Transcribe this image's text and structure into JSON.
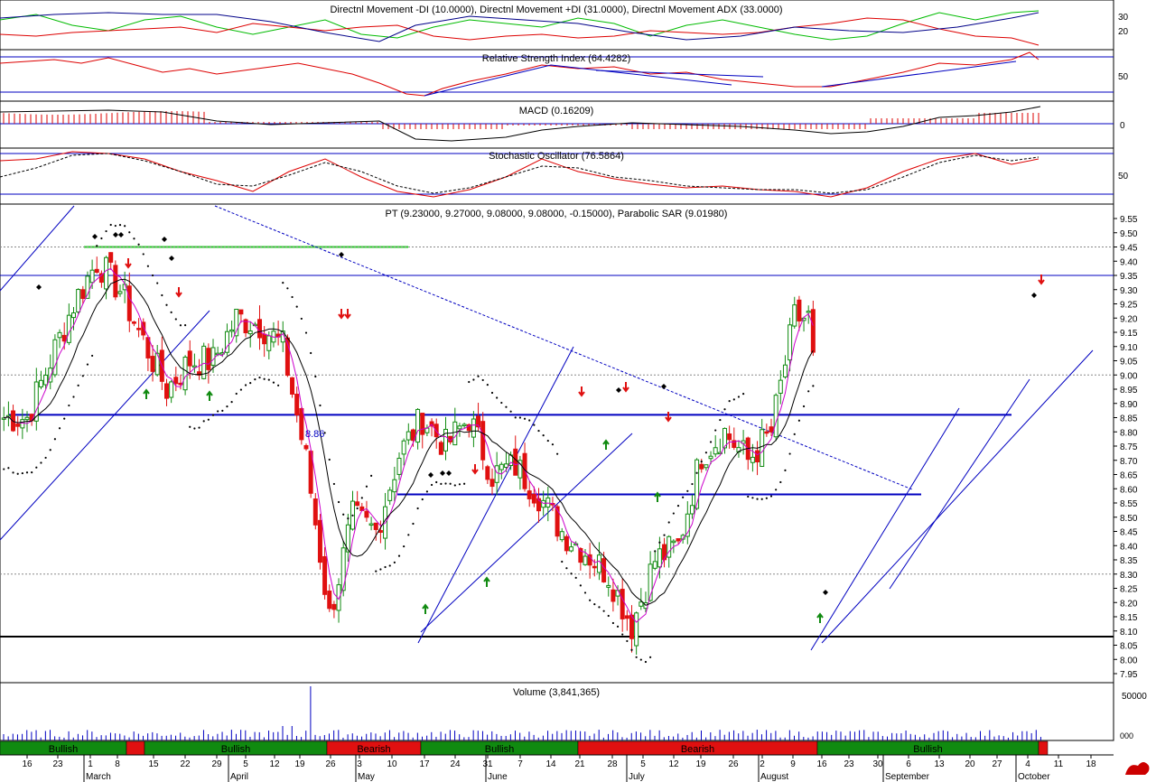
{
  "panels": {
    "dmi": {
      "title": "Directnl Movement -DI (10.0000), Directnl Movement +DI (31.0000), Directnl Movement ADX (33.0000)",
      "ticks": [
        "30",
        "20"
      ]
    },
    "rsi": {
      "title": "Relative Strength Index (64.4282)",
      "ticks": [
        "50"
      ]
    },
    "macd": {
      "title": "MACD (0.16209)",
      "ticks": [
        "0"
      ]
    },
    "stoch": {
      "title": "Stochastic Oscillator (76.5864)",
      "ticks": [
        "50"
      ]
    },
    "price": {
      "title": "PT (9.23000, 9.27000, 9.08000, 9.08000, -0.15000), Parabolic SAR (9.01980)",
      "annotation": "8.86",
      "ticks": [
        "9.55",
        "9.50",
        "9.45",
        "9.40",
        "9.35",
        "9.30",
        "9.25",
        "9.20",
        "9.15",
        "9.10",
        "9.05",
        "9.00",
        "8.95",
        "8.90",
        "8.85",
        "8.80",
        "8.75",
        "8.70",
        "8.65",
        "8.60",
        "8.55",
        "8.50",
        "8.45",
        "8.40",
        "8.35",
        "8.30",
        "8.25",
        "8.20",
        "8.15",
        "8.10",
        "8.05",
        "8.00",
        "7.95"
      ]
    },
    "volume": {
      "title": "Volume (3,841,365)",
      "ticks": [
        "50000",
        "000"
      ]
    }
  },
  "trend_bar": [
    {
      "label": "Bullish",
      "color": "#108a10"
    },
    {
      "label": "",
      "color": "#e01010"
    },
    {
      "label": "Bullish",
      "color": "#108a10"
    },
    {
      "label": "Bearish",
      "color": "#e01010"
    },
    {
      "label": "Bullish",
      "color": "#108a10"
    },
    {
      "label": "Bearish",
      "color": "#e01010"
    },
    {
      "label": "Bullish",
      "color": "#108a10"
    },
    {
      "label": "",
      "color": "#e01010"
    }
  ],
  "x_axis": {
    "days": [
      "16",
      "23",
      "1",
      "8",
      "15",
      "22",
      "29",
      "5",
      "12",
      "19",
      "26",
      "3",
      "10",
      "17",
      "24",
      "31",
      "7",
      "14",
      "21",
      "28",
      "5",
      "12",
      "19",
      "26",
      "2",
      "9",
      "16",
      "23",
      "30",
      "6",
      "13",
      "20",
      "27",
      "4",
      "11",
      "18"
    ],
    "months": [
      "March",
      "April",
      "May",
      "June",
      "July",
      "August",
      "September",
      "October"
    ]
  },
  "colors": {
    "up": "#108a10",
    "down": "#e01010",
    "inside": "#1010e0",
    "ma_fast": "#cc00cc",
    "ma_slow": "#000000",
    "level_line": "#0000c0",
    "resistance": "#22cc22"
  },
  "chart_data": {
    "type": "candlestick",
    "title": "PT (9.23000, 9.27000, 9.08000, 9.08000, -0.15000), Parabolic SAR (9.01980)",
    "last_bar": {
      "open": 9.23,
      "high": 9.27,
      "low": 9.08,
      "close": 9.08,
      "change": -0.15
    },
    "parabolic_sar": 9.0198,
    "ylim": [
      7.95,
      9.55
    ],
    "horizontal_levels": [
      9.45,
      9.35,
      8.86,
      8.58,
      8.08
    ],
    "labeled_level": 8.86,
    "approx_closes_by_week": [
      {
        "date": "16",
        "close": 8.85
      },
      {
        "date": "23",
        "close": 9.05
      },
      {
        "date": "1",
        "close": 9.25
      },
      {
        "date": "8",
        "close": 9.4
      },
      {
        "date": "15",
        "close": 9.3
      },
      {
        "date": "22",
        "close": 9.12
      },
      {
        "date": "29",
        "close": 8.95
      },
      {
        "date": "5",
        "close": 9.05
      },
      {
        "date": "12",
        "close": 9.05
      },
      {
        "date": "19",
        "close": 9.2
      },
      {
        "date": "26",
        "close": 9.18
      },
      {
        "date": "3",
        "close": 9.1
      },
      {
        "date": "10",
        "close": 8.7
      },
      {
        "date": "17",
        "close": 8.15
      },
      {
        "date": "24",
        "close": 8.5
      },
      {
        "date": "31",
        "close": 8.45
      },
      {
        "date": "7",
        "close": 8.72
      },
      {
        "date": "14",
        "close": 8.85
      },
      {
        "date": "21",
        "close": 8.75
      },
      {
        "date": "28",
        "close": 8.85
      },
      {
        "date": "5",
        "close": 8.65
      },
      {
        "date": "12",
        "close": 8.68
      },
      {
        "date": "19",
        "close": 8.58
      },
      {
        "date": "26",
        "close": 8.45
      },
      {
        "date": "2",
        "close": 8.38
      },
      {
        "date": "9",
        "close": 8.3
      },
      {
        "date": "16",
        "close": 8.12
      },
      {
        "date": "23",
        "close": 8.35
      },
      {
        "date": "30",
        "close": 8.4
      },
      {
        "date": "6",
        "close": 8.72
      },
      {
        "date": "13",
        "close": 8.8
      },
      {
        "date": "20",
        "close": 8.7
      },
      {
        "date": "27",
        "close": 8.8
      },
      {
        "date": "4",
        "close": 9.2
      }
    ],
    "indicators": {
      "dmi_minus": 10.0,
      "dmi_plus": 31.0,
      "adx": 33.0,
      "rsi": 64.4282,
      "macd": 0.16209,
      "stochastic": 76.5864,
      "volume": 3841365
    }
  }
}
